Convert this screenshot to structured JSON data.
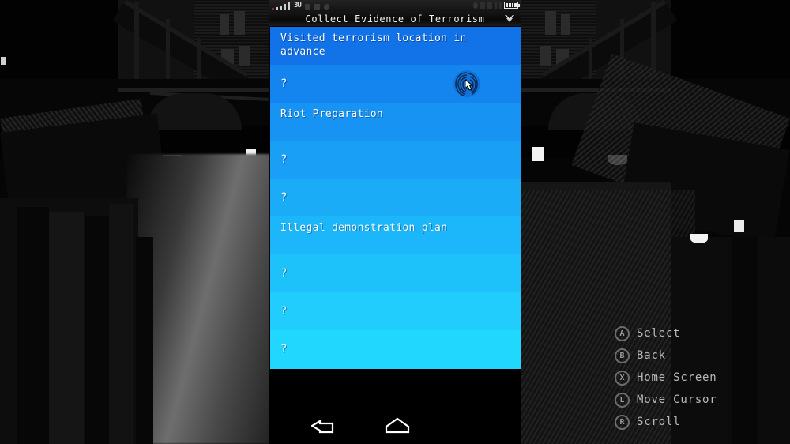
{
  "phone": {
    "statusbar": {
      "network_label": "3U",
      "signal_bars": 4,
      "battery_level": 4
    },
    "titlebar": {
      "title": "Collect Evidence of Terrorism",
      "expand_icon": "chevron-down-icon"
    },
    "list": [
      {
        "label": "Visited terrorism location in advance",
        "type": "evidence",
        "color": "#1273e8",
        "has_fingerprint": false
      },
      {
        "label": "?",
        "type": "unknown",
        "color": "#1485ef",
        "has_fingerprint": true
      },
      {
        "label": "Riot Preparation",
        "type": "evidence",
        "color": "#1793f3",
        "has_fingerprint": false
      },
      {
        "label": "?",
        "type": "unknown",
        "color": "#19a0f6",
        "has_fingerprint": false
      },
      {
        "label": "?",
        "type": "unknown",
        "color": "#1bacf8",
        "has_fingerprint": false
      },
      {
        "label": "Illegal demonstration plan",
        "type": "evidence",
        "color": "#1cb7fa",
        "has_fingerprint": false
      },
      {
        "label": "?",
        "type": "unknown",
        "color": "#1ec2fb",
        "has_fingerprint": false
      },
      {
        "label": "?",
        "type": "unknown",
        "color": "#20cdfd",
        "has_fingerprint": false
      },
      {
        "label": "?",
        "type": "unknown",
        "color": "#22d7fe",
        "has_fingerprint": false
      }
    ],
    "navbar": {
      "back_icon": "back-arrow-icon",
      "home_icon": "home-icon"
    }
  },
  "button_hints": [
    {
      "button": "A",
      "label": "Select"
    },
    {
      "button": "B",
      "label": "Back"
    },
    {
      "button": "X",
      "label": "Home Screen"
    },
    {
      "button": "L",
      "label": "Move Cursor"
    },
    {
      "button": "R",
      "label": "Scroll"
    }
  ],
  "colors": {
    "list_top": "#1273e8",
    "list_bottom": "#22d7fe",
    "text": "#ffffff",
    "hint_text": "#b9b9b9"
  }
}
